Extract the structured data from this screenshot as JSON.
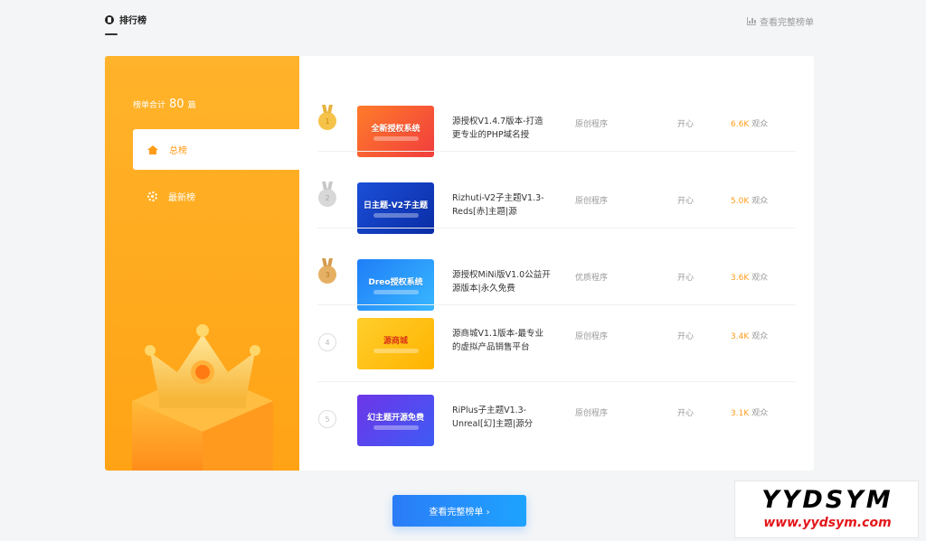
{
  "header": {
    "title": "排行榜",
    "more_link": "查看完整榜单"
  },
  "sidebar": {
    "total_label": "榜单合计",
    "total_count": "80",
    "total_unit": "篇",
    "nav": [
      {
        "label": "总榜",
        "icon": "home-icon",
        "active": true
      },
      {
        "label": "最新榜",
        "icon": "gear-icon",
        "active": false
      }
    ]
  },
  "ranking": [
    {
      "rank": "1",
      "thumb_text": "全新授权系统",
      "title": "源授权V1.4.7版本-打造更专业的PHP域名授",
      "category": "原创程序",
      "author": "开心",
      "views": "6.6K",
      "views_unit": "观众"
    },
    {
      "rank": "2",
      "thumb_text": "日主题-V2子主题",
      "title": "Rizhuti-V2子主题V1.3-Reds[赤]主题|源",
      "category": "原创程序",
      "author": "开心",
      "views": "5.0K",
      "views_unit": "观众"
    },
    {
      "rank": "3",
      "thumb_text": "Dreo授权系统",
      "title": "源授权MiNi版V1.0公益开源版本|永久免费",
      "category": "优质程序",
      "author": "开心",
      "views": "3.6K",
      "views_unit": "观众"
    },
    {
      "rank": "4",
      "thumb_text": "源商城",
      "title": "源商城V1.1版本-最专业的虚拟产品销售平台",
      "category": "原创程序",
      "author": "开心",
      "views": "3.4K",
      "views_unit": "观众"
    },
    {
      "rank": "5",
      "thumb_text": "幻主题开源免费",
      "title": "RiPlus子主题V1.3-Unreal[幻]主题|源分",
      "category": "原创程序",
      "author": "开心",
      "views": "3.1K",
      "views_unit": "观众"
    }
  ],
  "cta": {
    "label": "查看完整榜单 ›"
  },
  "watermark": {
    "top": "YYDSYM",
    "bottom": "www.yydsym.com"
  },
  "colors": {
    "accent": "#ff9c1a",
    "sidebar": "#ffab20",
    "button": "#2a7cf7"
  }
}
